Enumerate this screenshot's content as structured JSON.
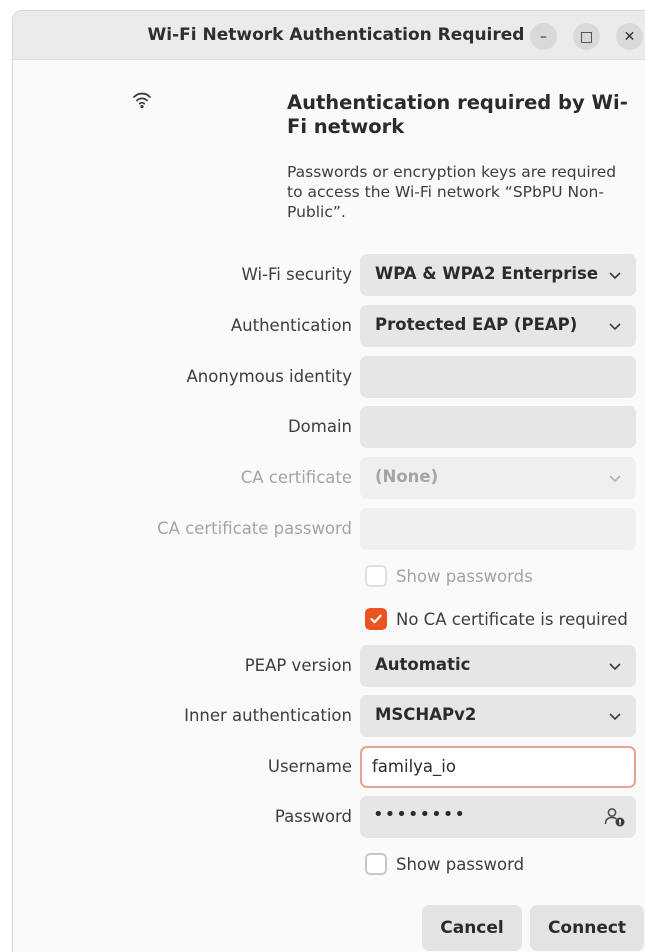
{
  "window": {
    "title": "Wi-Fi Network Authentication Required",
    "minimize_glyph": "–",
    "maximize_glyph": "□",
    "close_glyph": "✕"
  },
  "header": {
    "icon": "wifi-icon",
    "heading": "Authentication required by Wi-Fi network",
    "description": "Passwords or encryption keys are required to access the Wi-Fi network “SPbPU Non-Public”."
  },
  "form": {
    "wifi_security": {
      "label": "Wi-Fi security",
      "value": "WPA & WPA2 Enterprise"
    },
    "authentication": {
      "label": "Authentication",
      "value": "Protected EAP (PEAP)"
    },
    "anonymous_identity": {
      "label": "Anonymous identity",
      "value": ""
    },
    "domain": {
      "label": "Domain",
      "value": ""
    },
    "ca_certificate": {
      "label": "CA certificate",
      "value": "(None)",
      "disabled": true
    },
    "ca_certificate_password": {
      "label": "CA certificate password",
      "value": "",
      "disabled": true
    },
    "show_passwords": {
      "label": "Show passwords",
      "checked": false,
      "disabled": true
    },
    "no_ca_required": {
      "label": "No CA certificate is required",
      "checked": true
    },
    "peap_version": {
      "label": "PEAP version",
      "value": "Automatic"
    },
    "inner_authentication": {
      "label": "Inner authentication",
      "value": "MSCHAPv2"
    },
    "username": {
      "label": "Username",
      "value": "familya_io"
    },
    "password": {
      "label": "Password",
      "masked": "••••••••"
    },
    "show_password": {
      "label": "Show password",
      "checked": false
    }
  },
  "buttons": {
    "cancel": "Cancel",
    "connect": "Connect"
  },
  "colors": {
    "accent": "#e95420",
    "focus_border": "#e8a393"
  }
}
